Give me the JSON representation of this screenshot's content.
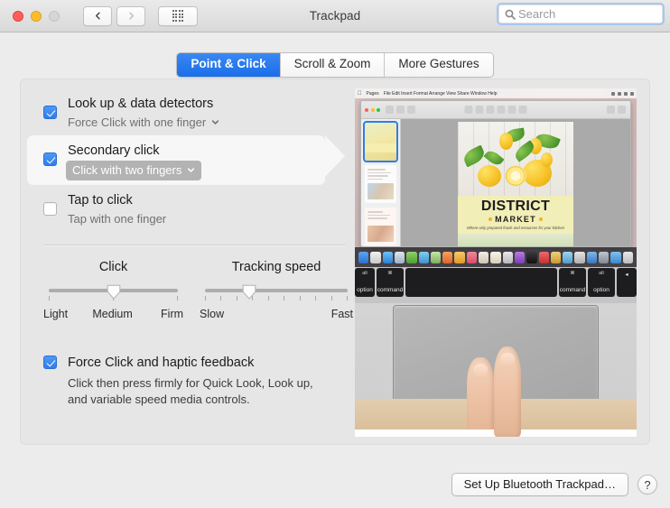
{
  "window": {
    "title": "Trackpad",
    "traffic_lights": [
      "close",
      "minimize",
      "zoom-disabled"
    ],
    "nav": {
      "back_icon": "chevron-left-icon",
      "forward_icon": "chevron-right-icon",
      "show_all_icon": "grid-icon"
    }
  },
  "search": {
    "placeholder": "Search",
    "value": "",
    "icon": "search-icon"
  },
  "tabs": [
    {
      "label": "Point & Click",
      "active": true
    },
    {
      "label": "Scroll & Zoom",
      "active": false
    },
    {
      "label": "More Gestures",
      "active": false
    }
  ],
  "options": [
    {
      "title": "Look up & data detectors",
      "subtitle": "Force Click with one finger",
      "checked": true,
      "has_popup": true,
      "popup_selected": false,
      "highlighted": false
    },
    {
      "title": "Secondary click",
      "subtitle": "Click with two fingers",
      "checked": true,
      "has_popup": true,
      "popup_selected": true,
      "highlighted": true
    },
    {
      "title": "Tap to click",
      "subtitle": "Tap with one finger",
      "checked": false,
      "has_popup": false,
      "popup_selected": false,
      "highlighted": false
    }
  ],
  "sliders": {
    "click": {
      "title": "Click",
      "labels": [
        "Light",
        "Medium",
        "Firm"
      ],
      "ticks": 3,
      "value_index": 1,
      "value_percent": 50
    },
    "tracking": {
      "title": "Tracking speed",
      "labels": [
        "Slow",
        "Fast"
      ],
      "ticks": 10,
      "value_index": 3,
      "value_percent": 33
    }
  },
  "force_click": {
    "title": "Force Click and haptic feedback",
    "description": "Click then press firmly for Quick Look, Look up, and variable speed media controls.",
    "checked": true
  },
  "footer": {
    "setup_button": "Set Up Bluetooth Trackpad…",
    "help_button": "?"
  },
  "preview": {
    "poster": {
      "title": "DISTRICT",
      "subtitle": "MARKET",
      "tagline": "Where only prepared foods and resources for your kitchen"
    },
    "keys": [
      {
        "top": "alt",
        "bottom": "option",
        "kind": "edge"
      },
      {
        "top": "⌘",
        "bottom": "command",
        "kind": "narrow"
      },
      {
        "top": "",
        "bottom": "",
        "kind": "space"
      },
      {
        "top": "⌘",
        "bottom": "command",
        "kind": "narrow"
      },
      {
        "top": "alt",
        "bottom": "option",
        "kind": "narrow"
      },
      {
        "top": "",
        "bottom": "◂",
        "kind": "edge"
      }
    ],
    "gesture_hint": "two-fingers-on-trackpad"
  },
  "colors": {
    "accent_blue": "#2f7dec",
    "tab_active": "#1a6fe8",
    "panel_bg": "#e6e6e6",
    "window_bg": "#ececec",
    "highlight_row": "#f7f7f7",
    "popup_selected_bg": "#b3b3b3"
  }
}
